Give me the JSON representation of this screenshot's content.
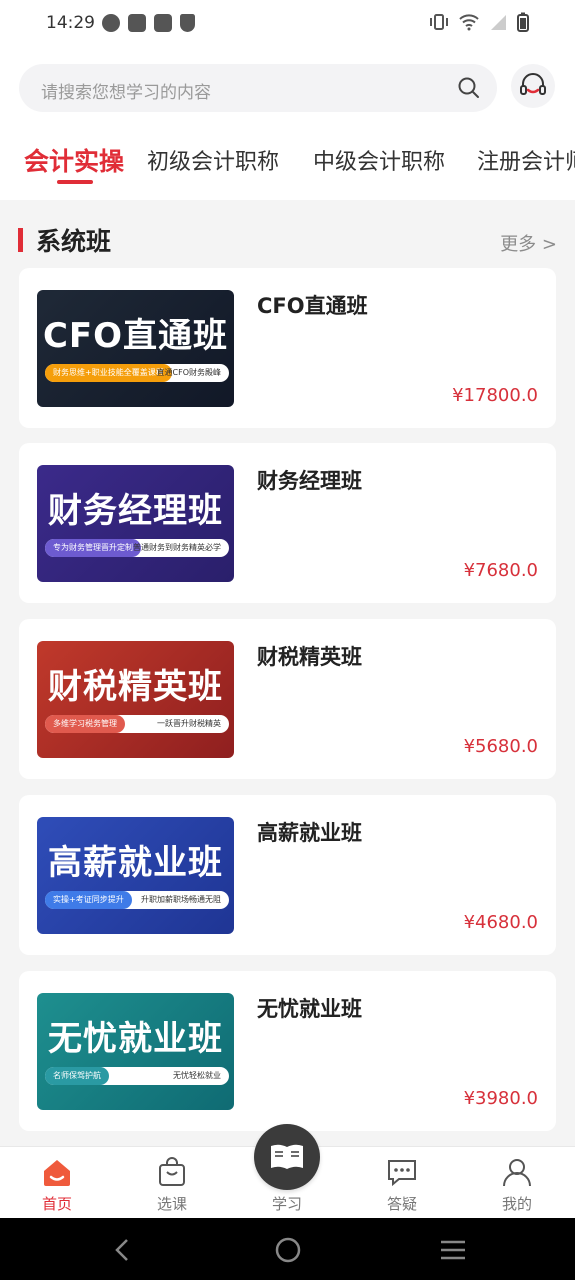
{
  "status_bar": {
    "time": "14:29"
  },
  "search": {
    "placeholder": "请搜索您想学习的内容"
  },
  "tabs": [
    {
      "label": "会计实操",
      "active": true
    },
    {
      "label": "初级会计职称"
    },
    {
      "label": "中级会计职称"
    },
    {
      "label": "注册会计师"
    }
  ],
  "section": {
    "title": "系统班",
    "more": "更多 >"
  },
  "courses": [
    {
      "name": "CFO直通班",
      "price": "¥17800.0",
      "thumb_title": "CFO直通班",
      "thumb_tag_left": "财务思维+职业技能全覆盖课程",
      "thumb_tag_right": "直通CFO财务殿峰",
      "colors": [
        "#1f2937",
        "#111827",
        "#f59e0b"
      ]
    },
    {
      "name": "财务经理班",
      "price": "¥7680.0",
      "thumb_title": "财务经理班",
      "thumb_tag_left": "专为财务管理晋升定制",
      "thumb_tag_right": "普通财务到财务精英必学",
      "colors": [
        "#3b2a8a",
        "#2a1f6b",
        "#6d5bd0"
      ]
    },
    {
      "name": "财税精英班",
      "price": "¥5680.0",
      "thumb_title": "财税精英班",
      "thumb_tag_left": "多维学习税务管理",
      "thumb_tag_right": "一跃晋升财税精英",
      "colors": [
        "#c0392b",
        "#8f1f1f",
        "#e05a4e"
      ]
    },
    {
      "name": "高薪就业班",
      "price": "¥4680.0",
      "thumb_title": "高薪就业班",
      "thumb_tag_left": "实操+考证同步提升",
      "thumb_tag_right": "升职加薪职场畅通无阻",
      "colors": [
        "#2f4db8",
        "#1f3594",
        "#3f7be8"
      ]
    },
    {
      "name": "无忧就业班",
      "price": "¥3980.0",
      "thumb_title": "无忧就业班",
      "thumb_tag_left": "名师保驾护航",
      "thumb_tag_right": "无忧轻松就业",
      "colors": [
        "#1e8f8f",
        "#0f6b73",
        "#2a9aa3"
      ]
    }
  ],
  "bottom_nav": [
    {
      "label": "首页",
      "icon": "home-icon",
      "active": true
    },
    {
      "label": "选课",
      "icon": "shopping-bag-icon"
    },
    {
      "label": "学习",
      "icon": "book-icon"
    },
    {
      "label": "答疑",
      "icon": "chat-icon"
    },
    {
      "label": "我的",
      "icon": "user-icon"
    }
  ],
  "colors": {
    "accent": "#e02d37",
    "price": "#d7313b"
  }
}
